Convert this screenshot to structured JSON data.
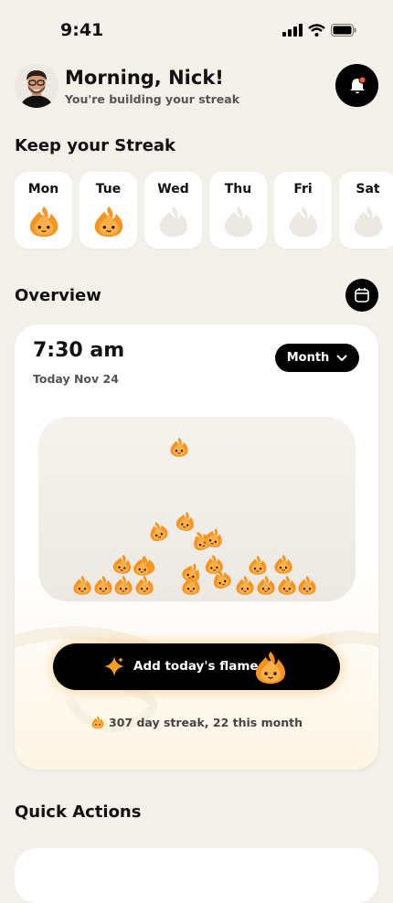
{
  "status_bar": {
    "time": "9:41"
  },
  "header": {
    "greeting": "Morning, Nick!",
    "subtitle": "You're building your streak"
  },
  "streak_section": {
    "title": "Keep your Streak",
    "days": [
      {
        "label": "Mon",
        "done": true
      },
      {
        "label": "Tue",
        "done": true
      },
      {
        "label": "Wed",
        "done": false
      },
      {
        "label": "Thu",
        "done": false
      },
      {
        "label": "Fri",
        "done": false
      },
      {
        "label": "Sat",
        "done": false
      }
    ]
  },
  "overview": {
    "title": "Overview",
    "time": "7:30 am",
    "date": "Today Nov 24",
    "period_select": "Month",
    "add_button_label": "Add today's flame",
    "streak_summary": "307 day streak, 22 this month"
  },
  "quick_actions": {
    "title": "Quick Actions"
  },
  "colors": {
    "accent": "#f7931e",
    "flame_light": "#fcb046",
    "inactive_flame": "#ece8e2"
  }
}
